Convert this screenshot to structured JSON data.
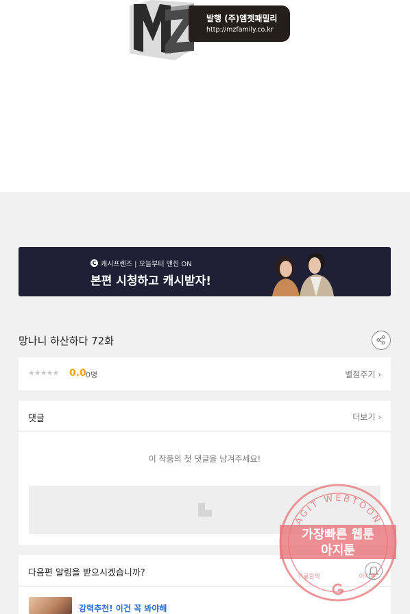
{
  "logo": {
    "letters": "MZ",
    "publisher": "발행 (주)엠젯패밀리",
    "url": "http://mzfamily.co.kr"
  },
  "banner": {
    "small_text": "캐시프렌즈 | 오늘부터 앤진 ON",
    "main_text": "본편 시청하고 캐시받자!",
    "colors": {
      "background": "#1f1f36"
    }
  },
  "episode": {
    "title": "망나니 하산하다 72화",
    "share_icon": "share-icon"
  },
  "rating": {
    "stars": "★★★★★",
    "score": "0.0",
    "count": "0명",
    "rate_label": "별점주기 ›"
  },
  "comments": {
    "label": "댓글",
    "more_label": "더보기 ›",
    "empty_message": "이 작품의 첫 댓글을 남겨주세요!"
  },
  "notify": {
    "question": "다음편 알림을 받으시겠습니까?",
    "bell_icon": "bell-icon",
    "recommend_text": "강력추천! 이건 꼭 봐야해"
  },
  "watermark": {
    "arc_text": "AGIT WEBTOON",
    "line1": "가장빠른 웹툰",
    "line2": "아지툰",
    "bottom_left": "구글검색",
    "bottom_right": "아지툰",
    "colors": {
      "stamp": "#e8747a"
    }
  }
}
